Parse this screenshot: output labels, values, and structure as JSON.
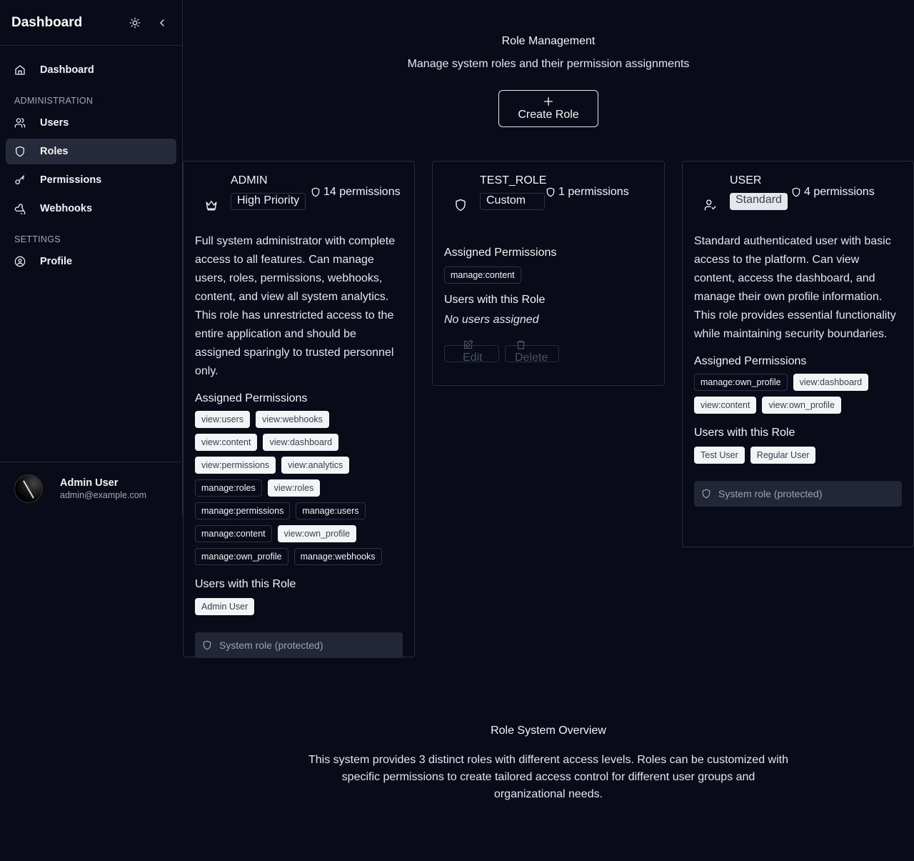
{
  "sidebar": {
    "title": "Dashboard",
    "nav_dashboard": "Dashboard",
    "section_admin": "ADMINISTRATION",
    "items": [
      {
        "label": "Users",
        "icon": "users-icon"
      },
      {
        "label": "Roles",
        "icon": "shield-icon"
      },
      {
        "label": "Permissions",
        "icon": "key-icon"
      },
      {
        "label": "Webhooks",
        "icon": "webhook-icon"
      }
    ],
    "section_settings": "SETTINGS",
    "profile": "Profile",
    "user": {
      "name": "Admin User",
      "email": "admin@example.com"
    }
  },
  "header": {
    "title": "Role Management",
    "subtitle": "Manage system roles and their permission assignments",
    "create_label": "Create Role"
  },
  "roles": [
    {
      "name": "ADMIN",
      "badge": "High Priority",
      "icon": "crown-icon",
      "perm_count": "14 permissions",
      "description": "Full system administrator with complete access to all features. Can manage users, roles, permissions, webhooks, content, and view all system analytics. This role has unrestricted access to the entire application and should be assigned sparingly to trusted personnel only.",
      "assigned_label": "Assigned Permissions",
      "permissions": [
        "view:users",
        "view:webhooks",
        "view:content",
        "view:dashboard",
        "view:permissions",
        "view:analytics",
        "manage:roles",
        "view:roles",
        "manage:permissions",
        "manage:users",
        "manage:content",
        "view:own_profile",
        "manage:own_profile",
        "manage:webhooks"
      ],
      "users_label": "Users with this Role",
      "users": [
        "Admin User"
      ],
      "protected": "System role (protected)"
    },
    {
      "name": "TEST_ROLE",
      "badge": "Custom",
      "icon": "shield-icon",
      "perm_count": "1 permissions",
      "assigned_label": "Assigned Permissions",
      "permissions": [
        "manage:content"
      ],
      "users_label": "Users with this Role",
      "no_users": "No users assigned",
      "edit": "Edit",
      "delete": "Delete"
    },
    {
      "name": "USER",
      "badge": "Standard",
      "icon": "user-check-icon",
      "perm_count": "4 permissions",
      "description": "Standard authenticated user with basic access to the platform. Can view content, access the dashboard, and manage their own profile information. This role provides essential functionality while maintaining security boundaries.",
      "assigned_label": "Assigned Permissions",
      "permissions": [
        "manage:own_profile",
        "view:dashboard",
        "view:content",
        "view:own_profile"
      ],
      "users_label": "Users with this Role",
      "users": [
        "Test User",
        "Regular User"
      ],
      "protected": "System role (protected)"
    }
  ],
  "overview": {
    "title": "Role System Overview",
    "text": "This system provides 3 distinct roles with different access levels. Roles can be customized with specific permissions to create tailored access control for different user groups and organizational needs."
  },
  "colors": {
    "background": "#0a0b19",
    "active_nav": "#272a3a",
    "protected_bg": "#222636"
  }
}
